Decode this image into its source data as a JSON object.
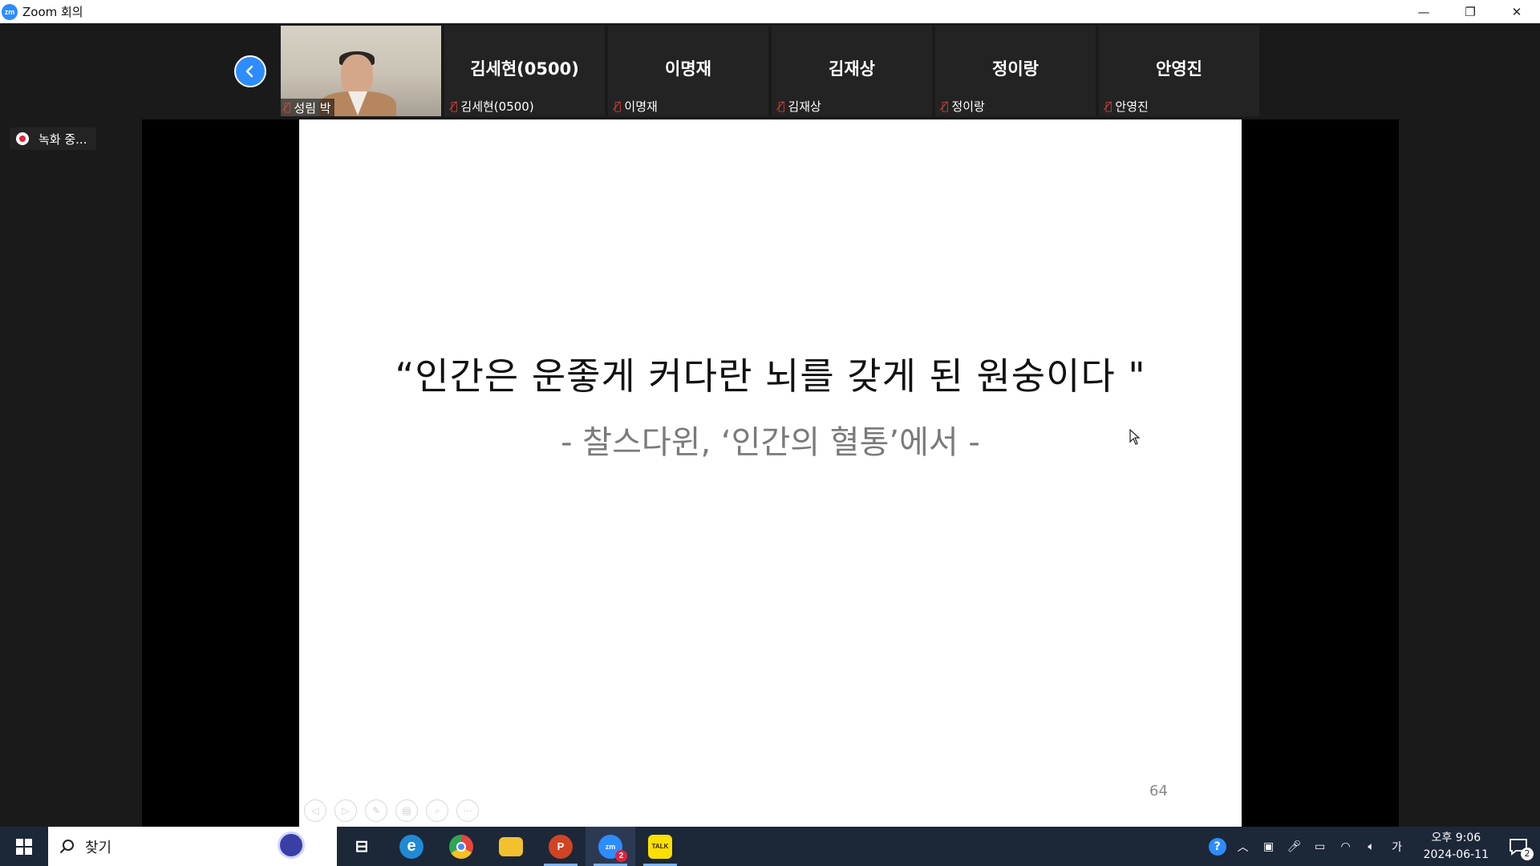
{
  "window": {
    "app_logo": "zm",
    "title": "Zoom 회의",
    "controls": {
      "minimize": "—",
      "restore": "❐",
      "close": "✕"
    }
  },
  "participants": [
    {
      "big_name": "",
      "small_name": "성림 박",
      "video": true,
      "muted": true
    },
    {
      "big_name": "김세현(0500)",
      "small_name": "김세현(0500)",
      "video": false,
      "muted": true
    },
    {
      "big_name": "이명재",
      "small_name": "이명재",
      "video": false,
      "muted": true
    },
    {
      "big_name": "김재상",
      "small_name": "김재상",
      "video": false,
      "muted": true
    },
    {
      "big_name": "정이랑",
      "small_name": "정이랑",
      "video": false,
      "muted": true
    },
    {
      "big_name": "안영진",
      "small_name": "안영진",
      "video": false,
      "muted": true
    }
  ],
  "recording": {
    "label": "녹화 중..."
  },
  "slide": {
    "quote": "“인간은 운좋게 커다란 뇌를 갖게 된 원숭이다 \"",
    "attribution": "- 찰스다윈, ‘인간의 혈통’에서 -",
    "page_number": "64"
  },
  "taskbar": {
    "search_placeholder": "찾기",
    "apps": [
      {
        "name": "task-view",
        "label": "⊟"
      },
      {
        "name": "edge",
        "label": "e",
        "color": "#1f8ad6"
      },
      {
        "name": "chrome",
        "label": "◉",
        "color": "#e8453c"
      },
      {
        "name": "file-explorer",
        "label": "▭",
        "color": "#f2c12e"
      },
      {
        "name": "powerpoint",
        "label": "P",
        "color": "#d04423"
      },
      {
        "name": "zoom",
        "label": "zm",
        "color": "#2D8CFF",
        "badge": "2",
        "active": true
      },
      {
        "name": "kakaotalk",
        "label": "TALK",
        "color": "#f9e000",
        "active": true
      }
    ],
    "ime": "가",
    "time": "오후 9:06",
    "date": "2024-06-11",
    "notification_count": "2"
  }
}
